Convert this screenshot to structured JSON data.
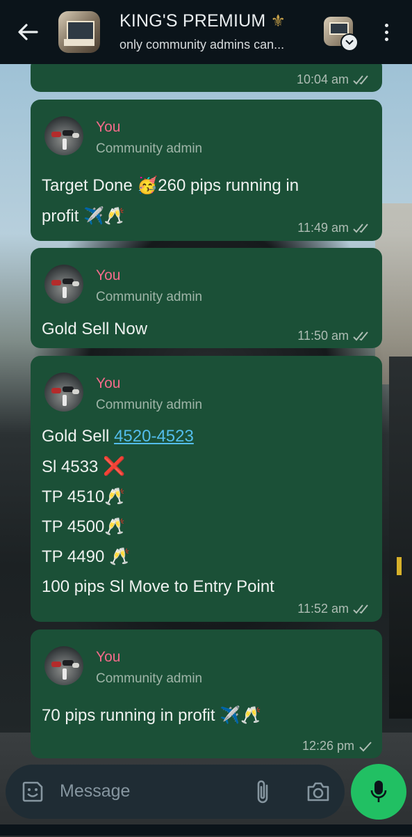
{
  "header": {
    "title": "KING'S PREMIUM",
    "title_glyph": "⚜",
    "subtitle": "only community admins can..."
  },
  "messages": [
    {
      "time": "10:04 am",
      "ticks": "double"
    },
    {
      "sender": "You",
      "role": "Community admin",
      "lines": [
        "Target Done 🥳260 pips running in",
        "profit ✈️🥂"
      ],
      "time": "11:49 am",
      "ticks": "double"
    },
    {
      "sender": "You",
      "role": "Community admin",
      "lines": [
        "Gold Sell Now"
      ],
      "time": "11:50 am",
      "ticks": "double"
    },
    {
      "sender": "You",
      "role": "Community admin",
      "line1_prefix": "Gold Sell ",
      "line1_link": "4520-4523",
      "line2": "Sl 4533 ",
      "line2_emoji": "❌",
      "line3": "TP 4510🥂",
      "line4": "TP 4500🥂",
      "line5": "TP 4490 🥂",
      "line6": "100 pips Sl Move to Entry Point",
      "time": "11:52 am",
      "ticks": "double"
    },
    {
      "sender": "You",
      "role": "Community admin",
      "lines": [
        "70 pips running in profit ✈️🥂"
      ],
      "time": "12:26 pm",
      "ticks": "single"
    }
  ],
  "input": {
    "placeholder": "Message"
  },
  "colors": {
    "bubble": "#1b5037",
    "header": "#0b141a",
    "sender": "#f26b8a",
    "link": "#53bdeb",
    "mic": "#21c063"
  }
}
